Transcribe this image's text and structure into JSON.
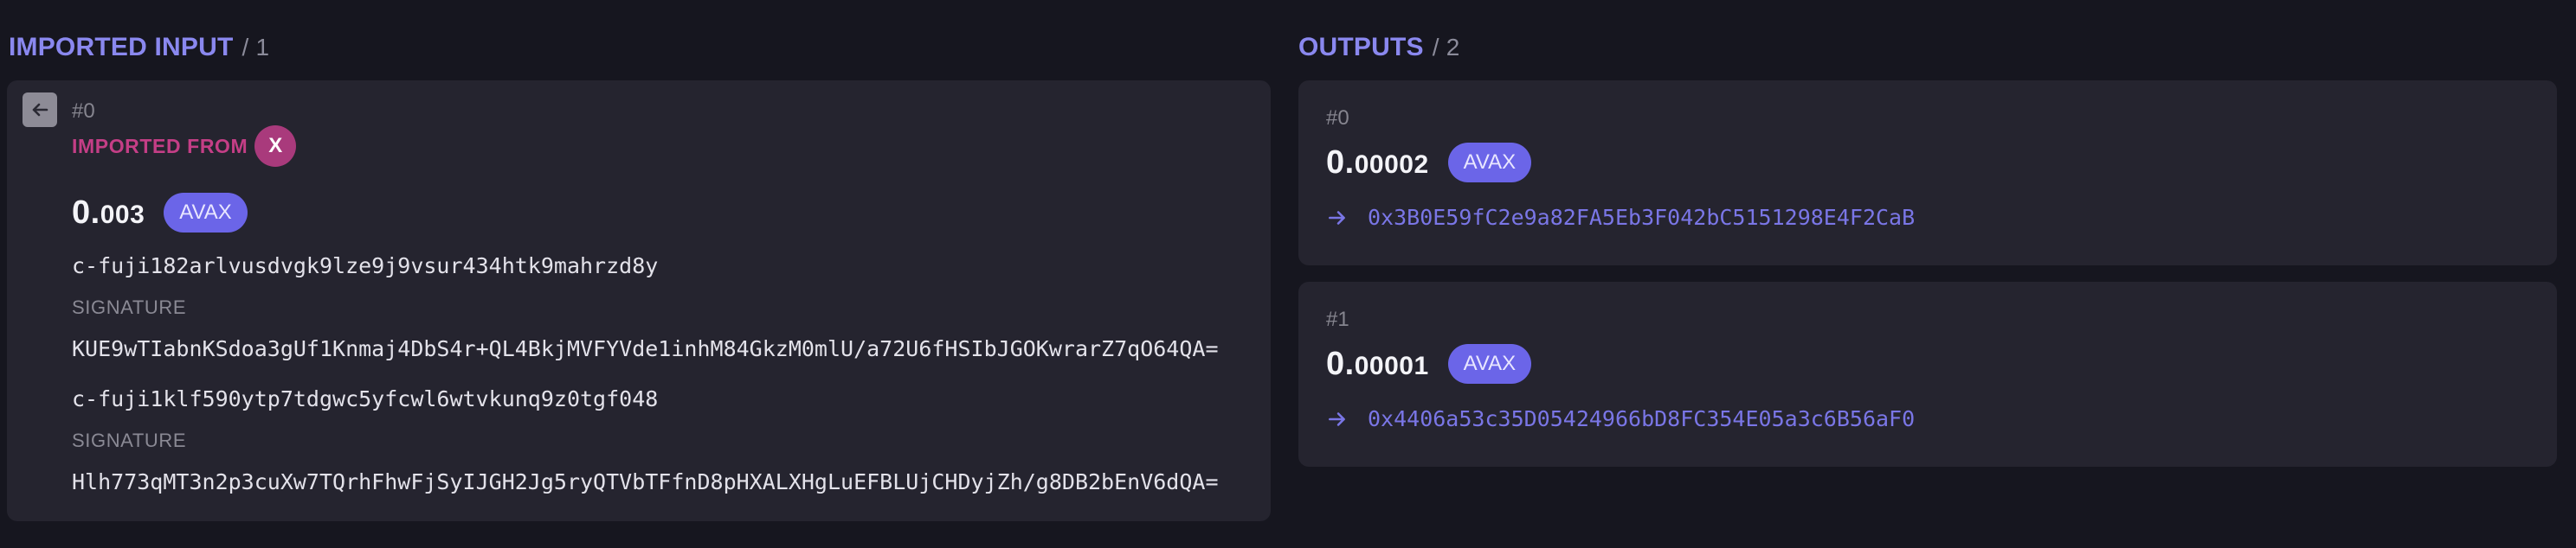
{
  "imported_input": {
    "title": "IMPORTED INPUT",
    "count": "/ 1",
    "items": [
      {
        "index": "#0",
        "imported_from_label": "IMPORTED FROM",
        "chain_badge": "X",
        "amount_whole": "0.",
        "amount_frac": "003",
        "asset": "AVAX",
        "credentials": [
          {
            "address": "c-fuji182arlvusdvgk9lze9j9vsur434htk9mahrzd8y",
            "signature_label": "SIGNATURE",
            "signature": "KUE9wTIabnKSdoa3gUf1Knmaj4DbS4r+QL4BkjMVFYVde1inhM84GkzM0mlU/a72U6fHSIbJGOKwrarZ7qO64QA="
          },
          {
            "address": "c-fuji1klf590ytp7tdgwc5yfcwl6wtvkunq9z0tgf048",
            "signature_label": "SIGNATURE",
            "signature": "Hlh773qMT3n2p3cuXw7TQrhFhwFjSyIJGH2Jg5ryQTVbTFfnD8pHXALXHgLuEFBLUjCHDyjZh/g8DB2bEnV6dQA="
          }
        ]
      }
    ],
    "back_icon": "arrow-left-icon"
  },
  "outputs": {
    "title": "OUTPUTS",
    "count": "/ 2",
    "items": [
      {
        "index": "#0",
        "amount_whole": "0.",
        "amount_frac": "00002",
        "asset": "AVAX",
        "address": "0x3B0E59fC2e9a82FA5Eb3F042bC5151298E4F2CaB"
      },
      {
        "index": "#1",
        "amount_whole": "0.",
        "amount_frac": "00001",
        "asset": "AVAX",
        "address": "0x4406a53c35D05424966bD8FC354E05a3c6B56aF0"
      }
    ],
    "arrow_icon": "arrow-right-icon"
  },
  "colors": {
    "background": "#16161f",
    "card": "#25242f",
    "accent": "#8a88ef",
    "pill": "#6b65e8",
    "imported_from": "#c43e86",
    "chain_badge": "#a93a7c"
  }
}
